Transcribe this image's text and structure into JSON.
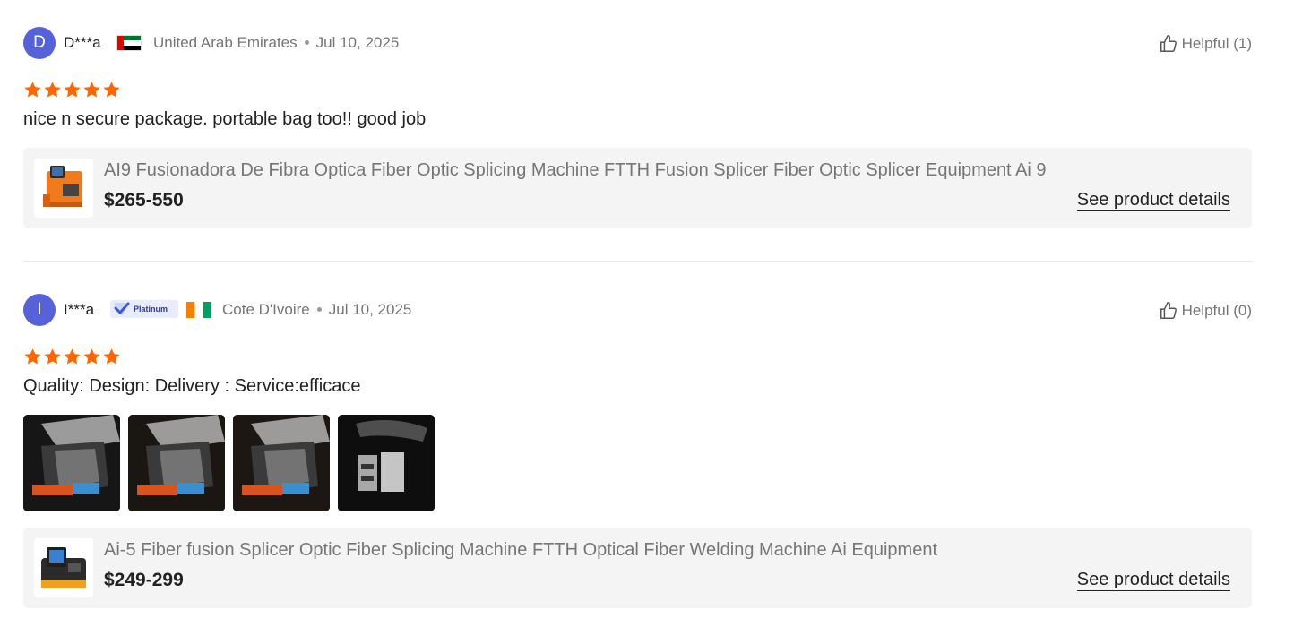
{
  "reviews": [
    {
      "avatar_letter": "D",
      "avatar_color": "#5562d9",
      "user": "D***a",
      "flag": "uae-flag",
      "country": "United Arab Emirates",
      "date": "Jul 10, 2025",
      "helpful": "Helpful (1)",
      "rating": 5,
      "comment": "nice n secure package. portable bag too!! good job",
      "product": {
        "title": "AI9 Fusionadora De Fibra Optica Fiber Optic Splicing Machine FTTH Fusion Splicer Fiber Optic Splicer Equipment Ai 9",
        "price": "$265-550",
        "details_link": "See product details"
      }
    },
    {
      "avatar_letter": "I",
      "avatar_color": "#5562d9",
      "user": "I***a",
      "badge": "Platinum",
      "flag": "cote-divoire-flag",
      "country": "Cote D'Ivoire",
      "date": "Jul 10, 2025",
      "helpful": "Helpful (0)",
      "rating": 5,
      "comment": "Quality: Design: Delivery : Service:efficace",
      "photos": 4,
      "product": {
        "title": "Ai-5 Fiber fusion Splicer Optic Fiber Splicing Machine FTTH Optical Fiber Welding Machine Ai Equipment",
        "price": "$249-299",
        "details_link": "See product details"
      }
    }
  ],
  "colors": {
    "star": "#ff6600",
    "accent": "#5562d9"
  }
}
